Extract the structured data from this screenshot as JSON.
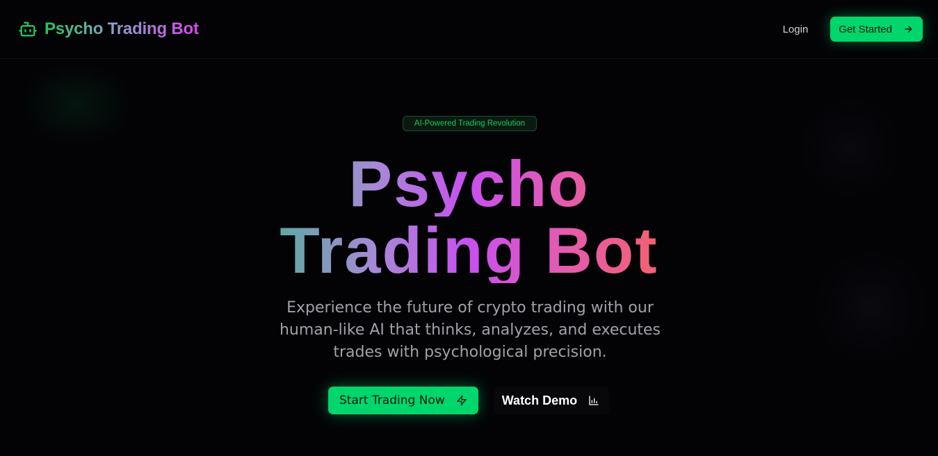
{
  "header": {
    "brand_icon": "robot-icon",
    "brand_name": "Psycho Trading Bot",
    "login_label": "Login",
    "get_started_label": "Get Started",
    "get_started_icon": "arrow-right-icon"
  },
  "hero": {
    "badge": "AI-Powered Trading Revolution",
    "title_line1": "Psycho",
    "title_line2": "Trading Bot",
    "subtitle": "Experience the future of crypto trading with our human-like AI that thinks, analyzes, and executes trades with psychological precision.",
    "primary_cta_label": "Start Trading Now",
    "primary_cta_icon": "lightning-icon",
    "secondary_cta_label": "Watch Demo",
    "secondary_cta_icon": "bar-chart-icon"
  },
  "colors": {
    "accent_green": "#00d66b",
    "background": "#030306",
    "gradient_start": "#5fa9a2",
    "gradient_mid": "#c850f0",
    "gradient_end": "#f2616f"
  }
}
